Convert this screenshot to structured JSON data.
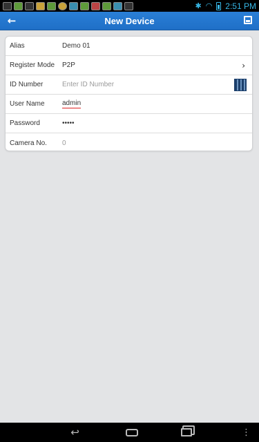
{
  "status_bar": {
    "time": "2:51 PM",
    "notifications": [
      "notif-1",
      "notif-2",
      "notif-3",
      "notif-4",
      "notif-5",
      "notif-6",
      "notif-7",
      "notif-8",
      "notif-9",
      "notif-10",
      "notif-11",
      "notif-12"
    ]
  },
  "appbar": {
    "title": "New Device",
    "back_icon": "back-arrow-icon",
    "save_icon": "save-icon"
  },
  "form": {
    "alias_label": "Alias",
    "alias_value": "Demo 01",
    "register_mode_label": "Register Mode",
    "register_mode_value": "P2P",
    "id_number_label": "ID Number",
    "id_number_placeholder": "Enter ID Number",
    "user_name_label": "User Name",
    "user_name_value": "admin",
    "password_label": "Password",
    "password_value": "•••••",
    "camera_no_label": "Camera No.",
    "camera_no_value": "0"
  },
  "colors": {
    "appbar": "#2a7fd6",
    "status_accent": "#37b7e6"
  }
}
